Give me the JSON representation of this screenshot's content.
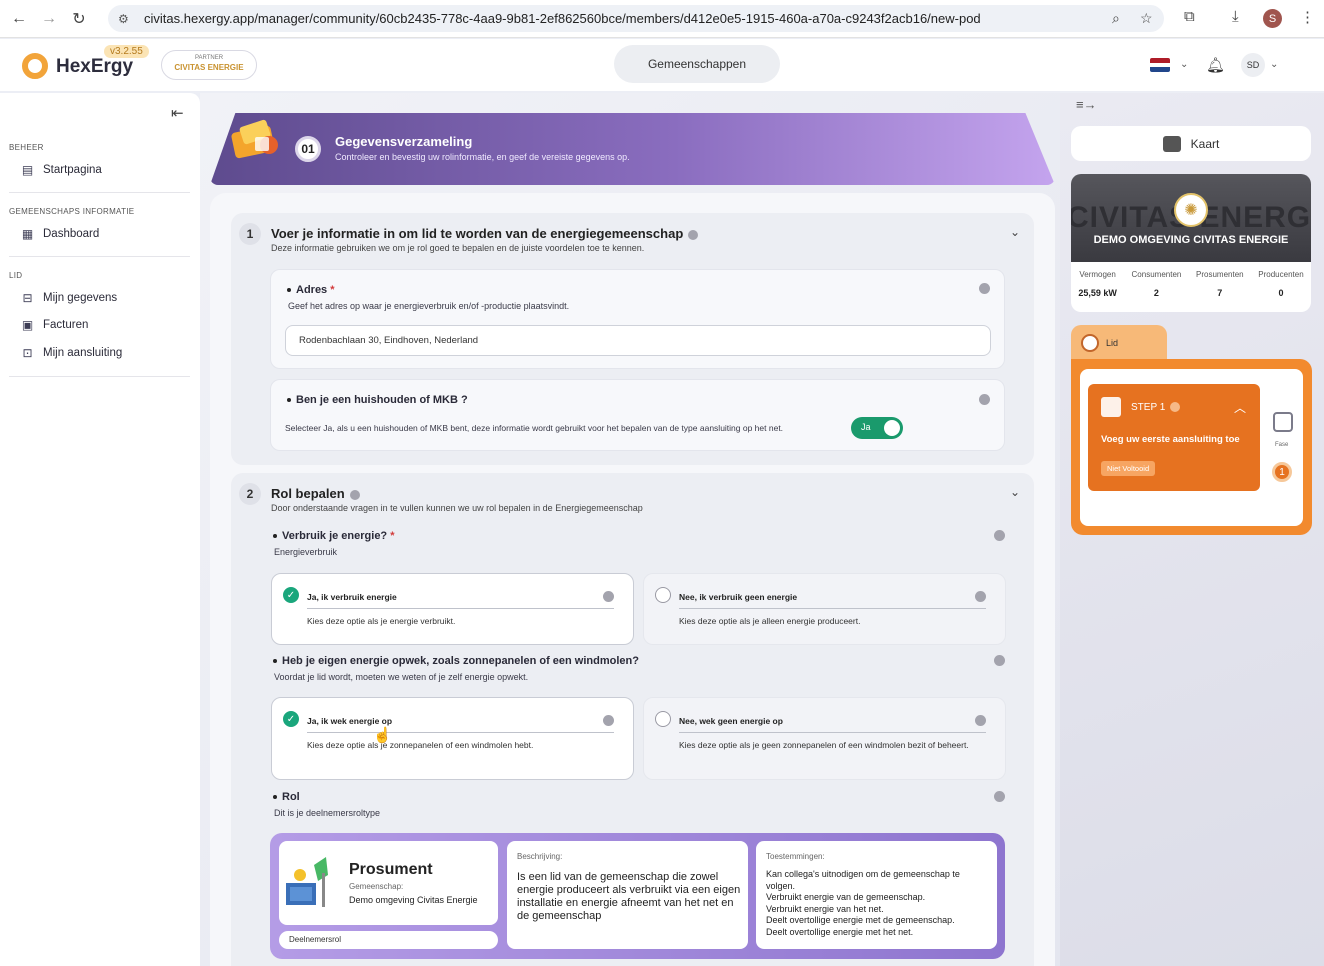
{
  "browser": {
    "url": "civitas.hexergy.app/manager/community/60cb2435-778c-4aa9-9b81-2ef862560bce/members/d412e0e5-1915-460a-a70a-c9243f2acb16/new-pod",
    "profile_initial": "S"
  },
  "header": {
    "brand": "HexErgy",
    "version": "v3.2.55",
    "partner_label": "PARTNER",
    "partner_name": "CIVITAS ENERGIE",
    "center_tab": "Gemeenschappen",
    "avatar_initials": "SD"
  },
  "sidebar": {
    "sections": [
      {
        "title": "BEHEER",
        "items": [
          {
            "label": "Startpagina",
            "icon": "home-page-icon"
          }
        ]
      },
      {
        "title": "GEMEENSCHAPS INFORMATIE",
        "items": [
          {
            "label": "Dashboard",
            "icon": "dashboard-icon"
          }
        ]
      },
      {
        "title": "LID",
        "items": [
          {
            "label": "Mijn gegevens",
            "icon": "user-data-icon"
          },
          {
            "label": "Facturen",
            "icon": "invoice-icon"
          },
          {
            "label": "Mijn aansluiting",
            "icon": "connection-icon"
          }
        ]
      }
    ]
  },
  "banner": {
    "step": "01",
    "title": "Gegevensverzameling",
    "subtitle": "Controleer en bevestig uw rolinformatie, en geef de vereiste gegevens op."
  },
  "section1": {
    "number": "1",
    "title": "Voer je informatie in om lid te worden van de energiegemeenschap",
    "description": "Deze informatie gebruiken we om je rol goed te bepalen en de juiste voordelen toe te kennen.",
    "address": {
      "label": "Adres",
      "required": "*",
      "help": "Geef het adres op waar je energieverbruik en/of -productie plaatsvindt.",
      "value": "Rodenbachlaan 30, Eindhoven, Nederland"
    },
    "household": {
      "label": "Ben je een huishouden of MKB ?",
      "help": "Selecteer Ja, als u een huishouden of MKB bent, deze informatie wordt gebruikt voor het bepalen van de type aansluiting op het net.",
      "toggle_label": "Ja"
    }
  },
  "section2": {
    "number": "2",
    "title": "Rol bepalen",
    "description": "Door onderstaande vragen in te vullen kunnen we uw rol bepalen in de Energiegemeenschap",
    "q1": {
      "label": "Verbruik je energie?",
      "required": "*",
      "sub": "Energieverbruik",
      "options": [
        {
          "label": "Ja, ik verbruik energie",
          "desc": "Kies deze optie als je energie verbruikt."
        },
        {
          "label": "Nee, ik verbruik geen energie",
          "desc": "Kies deze optie als je alleen energie produceert."
        }
      ]
    },
    "q2": {
      "label": "Heb je eigen energie opwek, zoals zonnepanelen of een windmolen?",
      "sub": "Voordat je lid wordt, moeten we weten of je zelf energie opwekt.",
      "options": [
        {
          "label": "Ja, ik wek energie op",
          "desc": "Kies deze optie als je zonnepanelen of een windmolen hebt."
        },
        {
          "label": "Nee, wek geen energie op",
          "desc": "Kies deze optie als je geen zonnepanelen of een windmolen bezit of beheert."
        }
      ]
    },
    "role": {
      "label": "Rol",
      "sub": "Dit is je deelnemersroltype",
      "name": "Prosument",
      "community_label": "Gemeenschap:",
      "community": "Demo omgeving Civitas Energie",
      "tag": "Deelnemersrol",
      "desc_label": "Beschrijving:",
      "desc": "Is een lid van de gemeenschap die zowel energie produceert als verbruikt via een eigen installatie en energie afneemt van het net en de gemeenschap",
      "perm_label": "Toestemmingen:",
      "permissions": [
        "Kan collega's uitnodigen om de gemeenschap te volgen.",
        "Verbruikt energie van de gemeenschap.",
        "Verbruikt energie van het net.",
        "Deelt overtollige energie met de gemeenschap.",
        "Deelt overtollige energie met het net."
      ]
    }
  },
  "right": {
    "map_button": "Kaart",
    "community": {
      "bg_text": "CIVITAS ENERGIE",
      "name": "DEMO OMGEVING CIVITAS ENERGIE",
      "stats": [
        {
          "label": "Vermogen",
          "value": "25,59 kW"
        },
        {
          "label": "Consumenten",
          "value": "2"
        },
        {
          "label": "Prosumenten",
          "value": "7"
        },
        {
          "label": "Producenten",
          "value": "0"
        }
      ]
    },
    "lid": {
      "tab": "Lid",
      "step_title": "STEP 1",
      "step_text": "Voeg uw eerste aansluiting toe",
      "status": "Niet Voltooid",
      "fase_label": "Fase",
      "fase_number": "1"
    }
  },
  "colors": {
    "accent": "#8a6dbf",
    "success": "#1aa67c",
    "orange": "#e67220"
  }
}
